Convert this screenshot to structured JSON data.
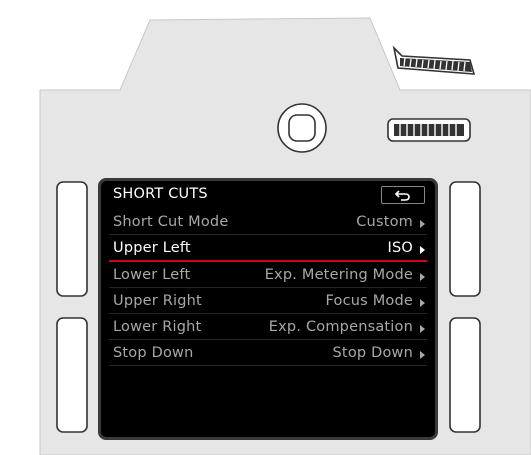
{
  "menu": {
    "title": "SHORT CUTS",
    "rows": [
      {
        "label": "Short Cut Mode",
        "value": "Custom"
      },
      {
        "label": "Upper Left",
        "value": "ISO"
      },
      {
        "label": "Lower Left",
        "value": "Exp. Metering Mode"
      },
      {
        "label": "Upper Right",
        "value": "Focus Mode"
      },
      {
        "label": "Lower Right",
        "value": "Exp. Compensation"
      },
      {
        "label": "Stop Down",
        "value": "Stop Down"
      }
    ],
    "selected_index": 1
  },
  "icons": {
    "back": "back-arrow-icon",
    "submenu": "chevron-right-icon"
  },
  "colors": {
    "body": "#e6e6e6",
    "screen": "#000000",
    "highlight_line": "#d0021b",
    "text_active": "#ffffff",
    "text_inactive": "#a8a8a8"
  }
}
